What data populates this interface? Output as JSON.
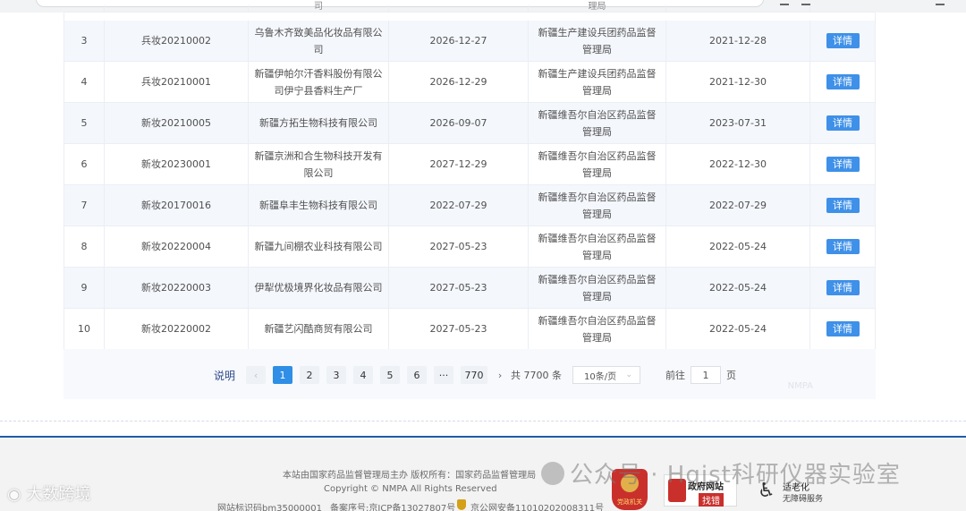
{
  "table": {
    "detail_label": "详情",
    "top_partial_text": "理局",
    "top_partial_text_2": "司",
    "rows": [
      {
        "no": "3",
        "license": "兵妆20210002",
        "company": "乌鲁木齐致美品化妆品有限公司",
        "valid_until": "2026-12-27",
        "authority": "新疆生产建设兵团药品监督管理局",
        "issue_date": "2021-12-28"
      },
      {
        "no": "4",
        "license": "兵妆20210001",
        "company": "新疆伊帕尔汗香料股份有限公司伊宁县香料生产厂",
        "valid_until": "2026-12-29",
        "authority": "新疆生产建设兵团药品监督管理局",
        "issue_date": "2021-12-30"
      },
      {
        "no": "5",
        "license": "新妆20210005",
        "company": "新疆方拓生物科技有限公司",
        "valid_until": "2026-09-07",
        "authority": "新疆维吾尔自治区药品监督管理局",
        "issue_date": "2023-07-31"
      },
      {
        "no": "6",
        "license": "新妆20230001",
        "company": "新疆京洲和合生物科技开发有限公司",
        "valid_until": "2027-12-29",
        "authority": "新疆维吾尔自治区药品监督管理局",
        "issue_date": "2022-12-30"
      },
      {
        "no": "7",
        "license": "新妆20170016",
        "company": "新疆阜丰生物科技有限公司",
        "valid_until": "2022-07-29",
        "authority": "新疆维吾尔自治区药品监督管理局",
        "issue_date": "2022-07-29"
      },
      {
        "no": "8",
        "license": "新妆20220004",
        "company": "新疆九间棚农业科技有限公司",
        "valid_until": "2027-05-23",
        "authority": "新疆维吾尔自治区药品监督管理局",
        "issue_date": "2022-05-24"
      },
      {
        "no": "9",
        "license": "新妆20220003",
        "company": "伊犁优极境界化妆品有限公司",
        "valid_until": "2027-05-23",
        "authority": "新疆维吾尔自治区药品监督管理局",
        "issue_date": "2022-05-24"
      },
      {
        "no": "10",
        "license": "新妆20220002",
        "company": "新疆艺闪酷商贸有限公司",
        "valid_until": "2027-05-23",
        "authority": "新疆维吾尔自治区药品监督管理局",
        "issue_date": "2022-05-24"
      }
    ]
  },
  "pagination": {
    "explain": "说明",
    "prev": "‹",
    "pages": [
      "1",
      "2",
      "3",
      "4",
      "5",
      "6"
    ],
    "ellipsis": "···",
    "last_page": "770",
    "next": "›",
    "total": "共 7700 条",
    "page_size": "10条/页",
    "goto_prefix": "前往",
    "goto_value": "1",
    "goto_suffix": "页",
    "watermark": "NMPA"
  },
  "footer": {
    "host": "本站由国家药品监督管理局主办 版权所有：国家药品监督管理局",
    "copyright": "Copyright © NMPA All Rights Reserved",
    "site_id": "网站标识码bm35000001",
    "icp": "备案序号:京ICP备13027807号",
    "police": "京公网安备11010202008311号",
    "gov_badge": "党政机关",
    "err_badge_title": "政府网站",
    "err_badge_action": "找错",
    "age_badge_title": "适老化",
    "age_badge_sub": "无障碍服务"
  },
  "overlays": {
    "wechat": "公众号 · Hgist科研仪器实验室",
    "left_mark": "大数跨境"
  }
}
